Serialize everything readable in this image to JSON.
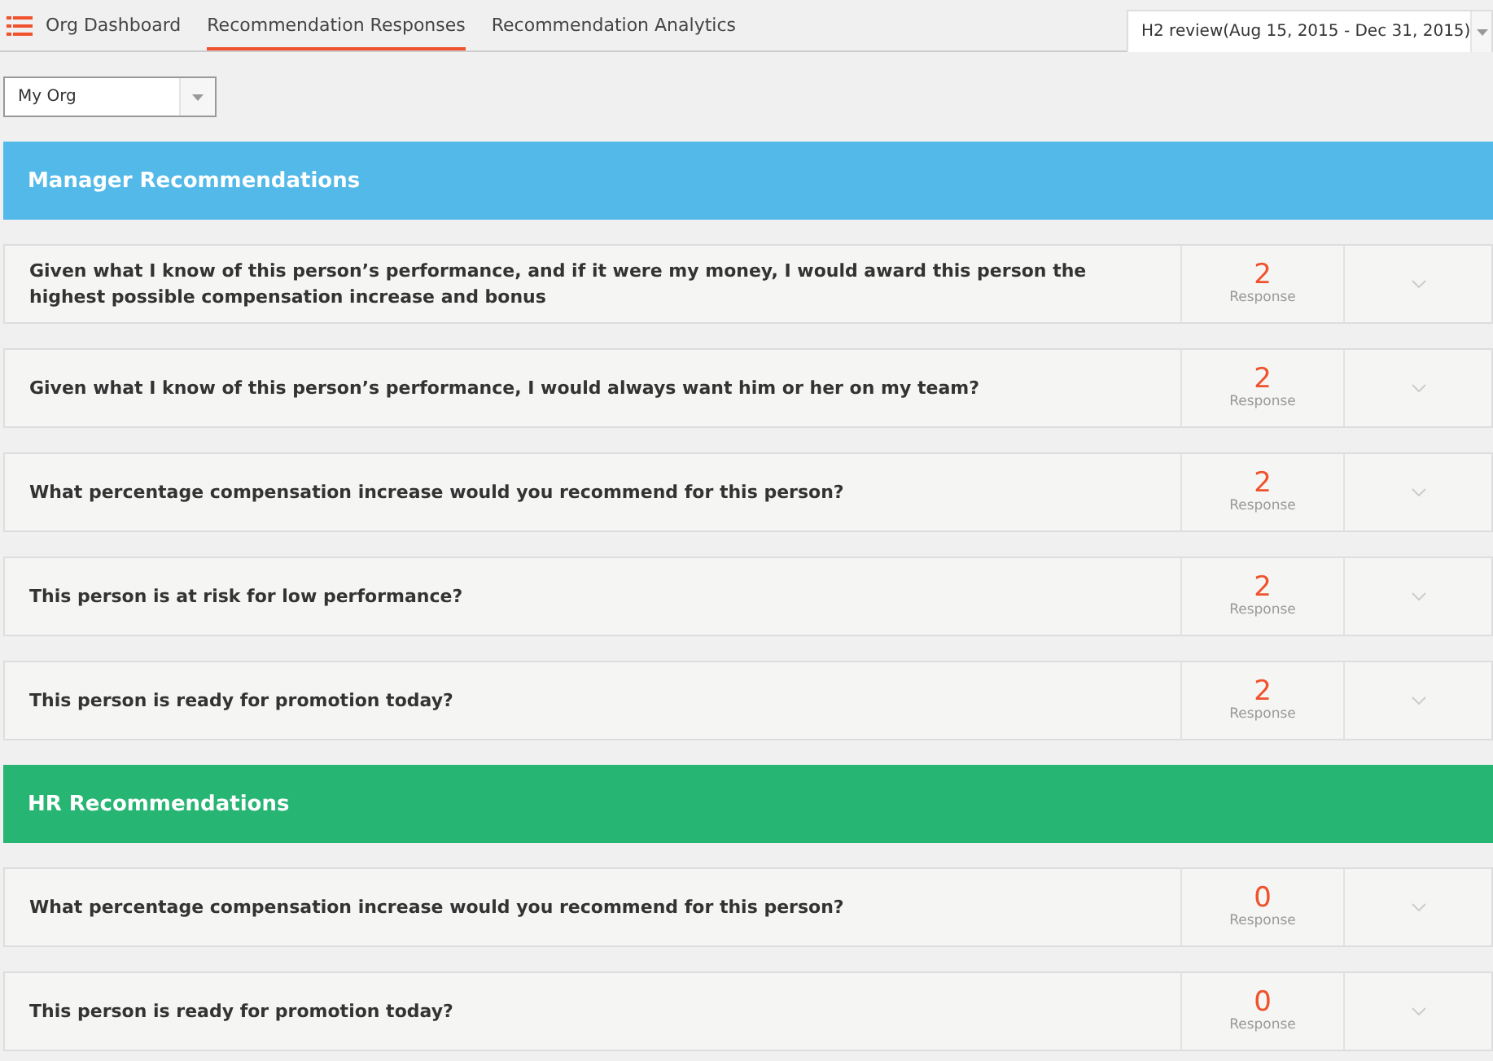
{
  "nav": {
    "tabs": [
      {
        "label": "Org Dashboard",
        "selected": false
      },
      {
        "label": "Recommendation Responses",
        "selected": true
      },
      {
        "label": "Recommendation Analytics",
        "selected": false
      }
    ],
    "period": "H2 review(Aug 15, 2015 - Dec 31, 2015)"
  },
  "org_select": "My Org",
  "sections": [
    {
      "title": "Manager Recommendations",
      "color": "#52b9e8",
      "questions": [
        {
          "text": "Given what I know of this person’s performance, and if it were my money, I would award this person the highest possible compensation increase and bonus",
          "count": "2",
          "count_label": "Response"
        },
        {
          "text": "Given what I know of this person’s performance, I would always want him or her on my team?",
          "count": "2",
          "count_label": "Response"
        },
        {
          "text": "What percentage compensation increase would you recommend for this person?",
          "count": "2",
          "count_label": "Response"
        },
        {
          "text": "This person is at risk for low performance?",
          "count": "2",
          "count_label": "Response"
        },
        {
          "text": "This person is ready for promotion today?",
          "count": "2",
          "count_label": "Response"
        }
      ]
    },
    {
      "title": "HR Recommendations",
      "color": "#27b573",
      "questions": [
        {
          "text": "What percentage compensation increase would you recommend for this person?",
          "count": "0",
          "count_label": "Response"
        },
        {
          "text": "This person is ready for promotion today?",
          "count": "0",
          "count_label": "Response"
        }
      ]
    }
  ]
}
